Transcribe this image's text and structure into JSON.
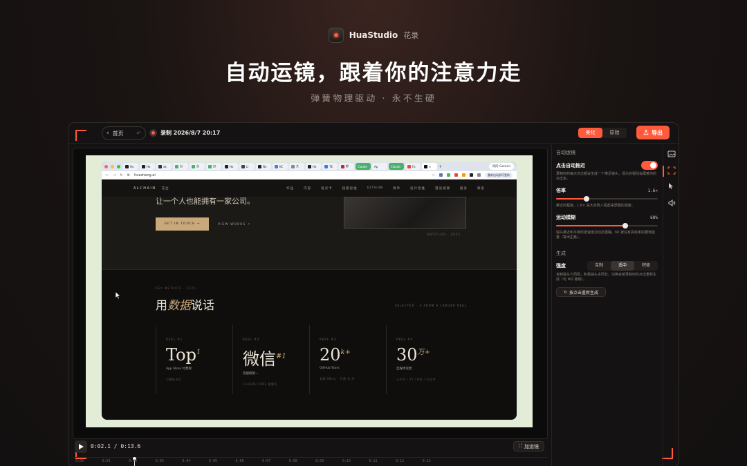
{
  "brand": {
    "name": "HuaStudio",
    "cn": "花录"
  },
  "headline": "自动运镜，跟着你的注意力走",
  "subhead": "弹簧物理驱动 · 永不生硬",
  "toolbar": {
    "home_label": "首页",
    "recording_title": "录制 2026/8/7 20:17",
    "mode_beautify": "美化",
    "mode_original": "原始",
    "export_label": "导出"
  },
  "browser": {
    "tabs": [
      "Ho",
      "Ho",
      "ak",
      "自",
      "自",
      "自",
      "Ho",
      "Li",
      "Ne",
      "KC",
      "文",
      "Ho",
      "TE",
      "都"
    ],
    "claude_tabs": [
      "Claude",
      "Ap",
      "Claude",
      "Fo"
    ],
    "gemini_label": "问问 Gemini",
    "url": "huasheng.ai",
    "restart_label": "重新启动即可更新"
  },
  "site": {
    "logo": "ALCHAIN",
    "logo_cn": "花生",
    "nav": [
      "作品",
      "内容",
      "观点卡",
      "短期思维",
      "GITHUB",
      "清单",
      "设计思维",
      "漫谈视频",
      "服务",
      "联系"
    ],
    "hero_text": "让一个人也能拥有一家公司。",
    "cta": "GET IN TOUCH →",
    "view_works": "VIEW WORKS ↗",
    "hero_caption": "UNTITLED · 2025",
    "metrics_label": "KEY METRICS · 2025",
    "metrics_title_pre": "用",
    "metrics_title_em": "数据",
    "metrics_title_post": "说话",
    "metrics_right": "SELECTED · A FROM A LARGER REEL.",
    "metrics": [
      {
        "label": "REEL #1",
        "value": "Top",
        "sup": "1",
        "sub": "App Store 付费榜",
        "foot": "小猫补光灯"
      },
      {
        "label": "REEL #2",
        "value": "微信",
        "sup": "#1",
        "sub": "热搜榜第一",
        "foot": "CLAUDE CODE 视频号"
      },
      {
        "label": "REEL #3",
        "value": "20",
        "sup": "k+",
        "sub": "GitHub Stars",
        "foot": "女娲 SKILL · 开源 仓 库"
      },
      {
        "label": "REEL #4",
        "value": "30",
        "sup": "万+",
        "sub": "自媒体读者",
        "foot": "公众号 / YT / B站 / 小红书"
      }
    ]
  },
  "playback": {
    "time": "0:02.1 / 0:13.6",
    "progress": 0.154,
    "motion_label": "加运镜",
    "ticks": [
      "0:00",
      "0:01",
      "0:02",
      "0:03",
      "0:04",
      "0:05",
      "0:06",
      "0:07",
      "0:08",
      "0:09",
      "0:10",
      "0:11",
      "0:12",
      "0:13"
    ]
  },
  "panel": {
    "section_auto": "自动运镜",
    "auto_push_label": "点击自动推近",
    "auto_push_on": true,
    "auto_push_desc": "录制时的每次点击都会生成一个推近镜头，观众的视线会跟着你的点击走。",
    "zoom_label": "倍率",
    "zoom_value": "1.6×",
    "zoom_fraction": 0.3,
    "zoom_desc": "推近的程度。1.6× 是大多数人看起来舒服的强度。",
    "blur_label": "运动模糊",
    "blur_value": "68%",
    "blur_fraction": 0.68,
    "blur_desc": "镜头推近和平移时按速度加动态模糊。60 被任有高级率的跟演能量（等出生路）。",
    "section_gen": "生成",
    "strength_label": "强度",
    "strength_options": [
      "克制",
      "适中",
      "积极"
    ],
    "strength_selected": 1,
    "strength_desc": "克制镜头少而短，积极镜头多而长。切换会按录制时的点击重新生成（可 ⌘Z 撤销）。",
    "regen_label": "按点击重新生成"
  },
  "colors": {
    "accent": "#ff5a3c",
    "canvas_bg": "#e2ecd6",
    "gold": "#c9a97c"
  }
}
